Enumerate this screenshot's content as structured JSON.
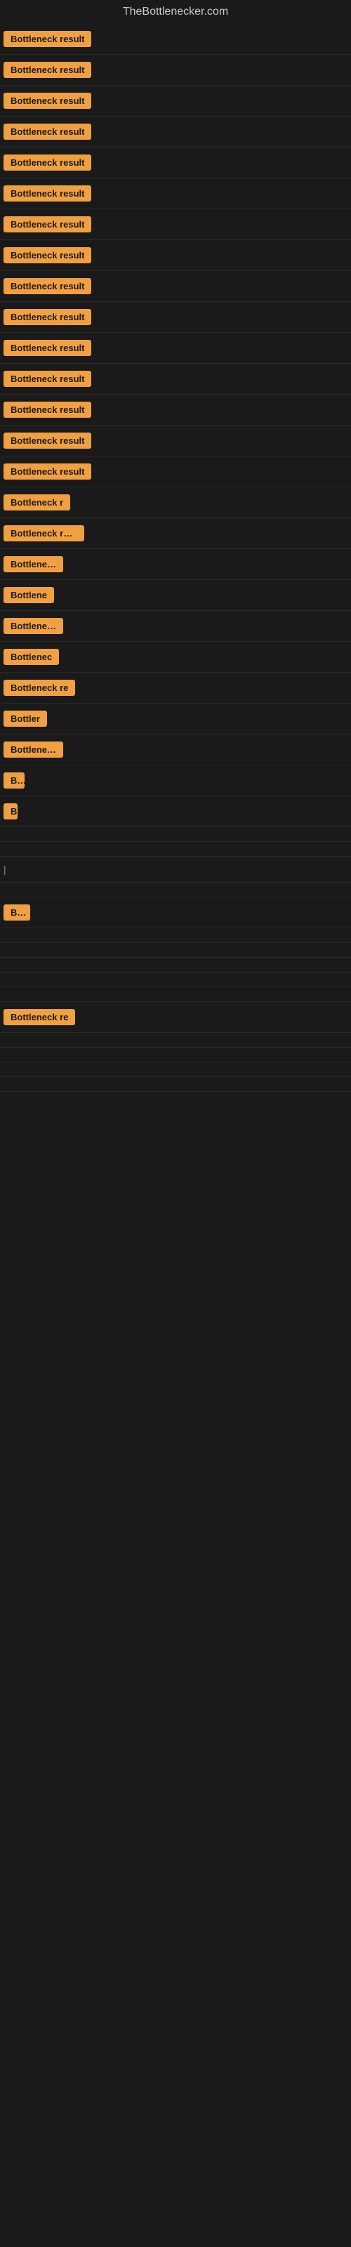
{
  "site": {
    "title": "TheBottlenecker.com"
  },
  "rows": [
    {
      "label": "Bottleneck result",
      "width": 140
    },
    {
      "label": "Bottleneck result",
      "width": 140
    },
    {
      "label": "Bottleneck result",
      "width": 140
    },
    {
      "label": "Bottleneck result",
      "width": 140
    },
    {
      "label": "Bottleneck result",
      "width": 140
    },
    {
      "label": "Bottleneck result",
      "width": 140
    },
    {
      "label": "Bottleneck result",
      "width": 140
    },
    {
      "label": "Bottleneck result",
      "width": 140
    },
    {
      "label": "Bottleneck result",
      "width": 140
    },
    {
      "label": "Bottleneck result",
      "width": 140
    },
    {
      "label": "Bottleneck result",
      "width": 140
    },
    {
      "label": "Bottleneck result",
      "width": 140
    },
    {
      "label": "Bottleneck result",
      "width": 140
    },
    {
      "label": "Bottleneck result",
      "width": 140
    },
    {
      "label": "Bottleneck result",
      "width": 135
    },
    {
      "label": "Bottleneck r",
      "width": 100
    },
    {
      "label": "Bottleneck resu",
      "width": 115
    },
    {
      "label": "Bottleneck",
      "width": 85
    },
    {
      "label": "Bottlene",
      "width": 75
    },
    {
      "label": "Bottleneck",
      "width": 85
    },
    {
      "label": "Bottlenec",
      "width": 80
    },
    {
      "label": "Bottleneck re",
      "width": 110
    },
    {
      "label": "Bottler",
      "width": 65
    },
    {
      "label": "Bottleneck",
      "width": 85
    },
    {
      "label": "Bo",
      "width": 30
    },
    {
      "label": "B",
      "width": 18
    },
    {
      "label": "",
      "width": 0
    },
    {
      "label": "",
      "width": 0
    },
    {
      "label": "|",
      "width": 10
    },
    {
      "label": "",
      "width": 0
    },
    {
      "label": "Bot",
      "width": 38
    },
    {
      "label": "",
      "width": 0
    },
    {
      "label": "",
      "width": 0
    },
    {
      "label": "",
      "width": 0
    },
    {
      "label": "",
      "width": 0
    },
    {
      "label": "",
      "width": 0
    },
    {
      "label": "Bottleneck re",
      "width": 110
    },
    {
      "label": "",
      "width": 0
    },
    {
      "label": "",
      "width": 0
    },
    {
      "label": "",
      "width": 0
    },
    {
      "label": "",
      "width": 0
    }
  ]
}
